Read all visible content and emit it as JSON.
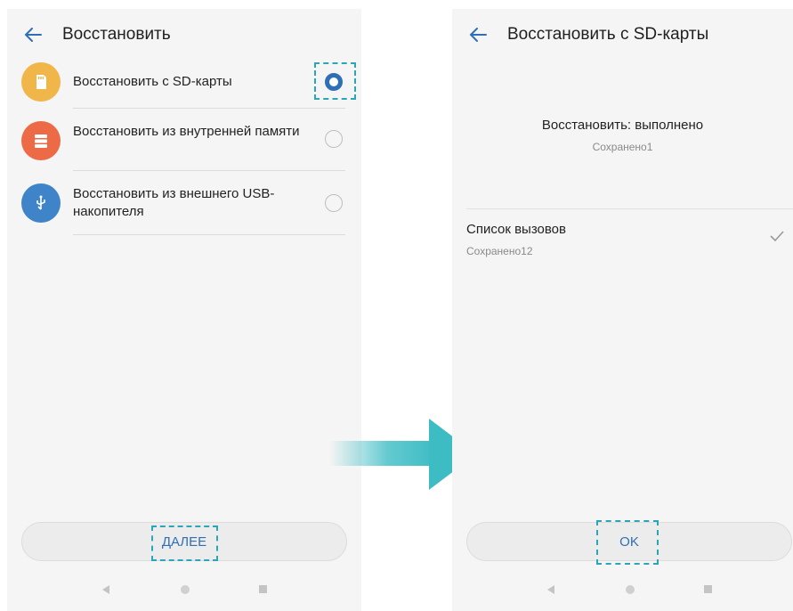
{
  "left_screen": {
    "title": "Восстановить",
    "options": [
      {
        "label": "Восстановить с SD-карты",
        "icon": "sd-card-icon",
        "color": "#f0b64a",
        "selected": true
      },
      {
        "label": "Восстановить из внутренней памяти",
        "icon": "storage-icon",
        "color": "#ec6a45",
        "selected": false
      },
      {
        "label": "Восстановить из внешнего USB-накопителя",
        "icon": "usb-icon",
        "color": "#3f83c9",
        "selected": false
      }
    ],
    "next_button": "ДАЛЕЕ"
  },
  "right_screen": {
    "title": "Восстановить с SD-карты",
    "status_title": "Восстановить: выполнено",
    "status_subtitle": "Сохранено1",
    "list": [
      {
        "title": "Список вызовов",
        "subtitle": "Сохранено12",
        "checked": true
      }
    ],
    "ok_button": "OK"
  },
  "colors": {
    "accent": "#2f6fb6",
    "highlight": "#2aa6b8",
    "arrow": "#3dbcc4"
  }
}
